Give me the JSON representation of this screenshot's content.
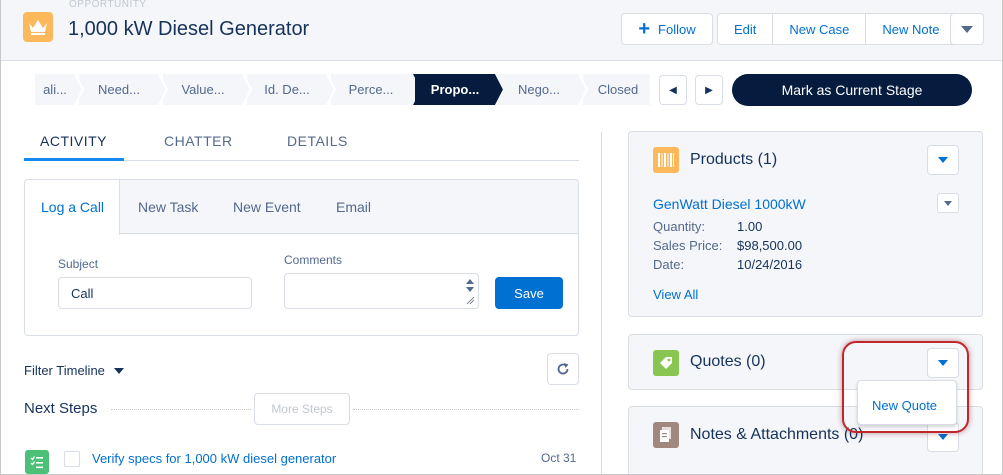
{
  "header": {
    "eyebrow": "OPPORTUNITY",
    "title": "1,000 kW Diesel Generator",
    "follow_label": "Follow",
    "actions": [
      "Edit",
      "New Case",
      "New Note"
    ]
  },
  "path": {
    "stages": [
      "ali...",
      "Need...",
      "Value...",
      "Id. De...",
      "Perce...",
      "Propo...",
      "Nego...",
      "Closed"
    ],
    "current_index": 5,
    "mark_button": "Mark as Current Stage"
  },
  "tabs": [
    "ACTIVITY",
    "CHATTER",
    "DETAILS"
  ],
  "composer": {
    "tabs": [
      "Log a Call",
      "New Task",
      "New Event",
      "Email"
    ],
    "subject_label": "Subject",
    "subject_value": "Call",
    "comments_label": "Comments",
    "save_label": "Save"
  },
  "timeline": {
    "filter_label": "Filter Timeline",
    "next_steps": "Next Steps",
    "more_steps": "More Steps",
    "task_title": "Verify specs for 1,000 kW diesel generator",
    "task_date": "Oct 31"
  },
  "products": {
    "title": "Products (1)",
    "item_name": "GenWatt Diesel 1000kW",
    "quantity_label": "Quantity:",
    "quantity_value": "1.00",
    "price_label": "Sales Price:",
    "price_value": "$98,500.00",
    "date_label": "Date:",
    "date_value": "10/24/2016",
    "view_all": "View All"
  },
  "quotes": {
    "title": "Quotes (0)",
    "menu_item": "New Quote"
  },
  "notes": {
    "title": "Notes & Attachments (0)"
  },
  "colors": {
    "brand": "#0070d2",
    "navy": "#061c3f",
    "highlight": "#c0272d",
    "opportunity_icon": "#fcb95b",
    "quotes_icon": "#88c651",
    "notes_icon": "#a1887f"
  }
}
